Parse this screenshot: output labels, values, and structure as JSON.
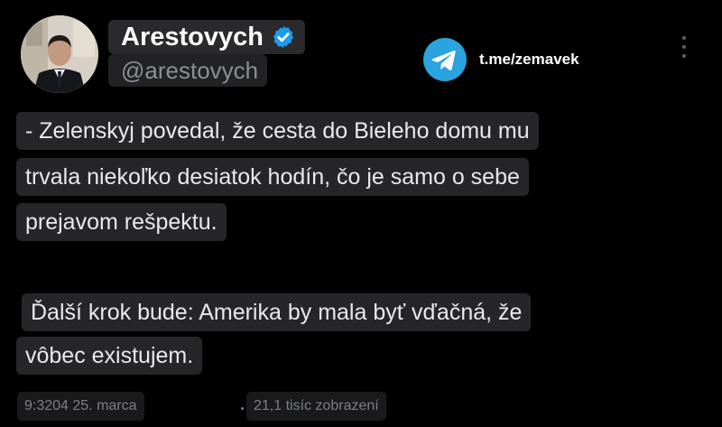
{
  "author": {
    "name": "Arestovych",
    "handle": "@arestovych",
    "verified": true,
    "avatar": "avatar-photo"
  },
  "promo": {
    "icon": "telegram-icon",
    "link": "t.me/zemavek"
  },
  "menu": {
    "icon": "more-vertical-icon"
  },
  "post": {
    "paragraph1": [
      "- Zelenskyj povedal, že cesta do Bieleho domu mu",
      "trvala niekoľko desiatok hodín, čo je samo o sebe",
      "prejavom rešpektu."
    ],
    "paragraph2": [
      "Ďalší krok bude: Amerika by mala byť vďačná, že",
      "vôbec existujem."
    ]
  },
  "meta": {
    "time_date": "9:3204 25. marca",
    "views": "21,1 tisíc zobrazení"
  },
  "colors": {
    "background": "#000000",
    "verified_badge": "#1d9bf0",
    "telegram": "#2aa3df",
    "text": "#e7e9ea",
    "secondary_text": "#8b8f94"
  }
}
